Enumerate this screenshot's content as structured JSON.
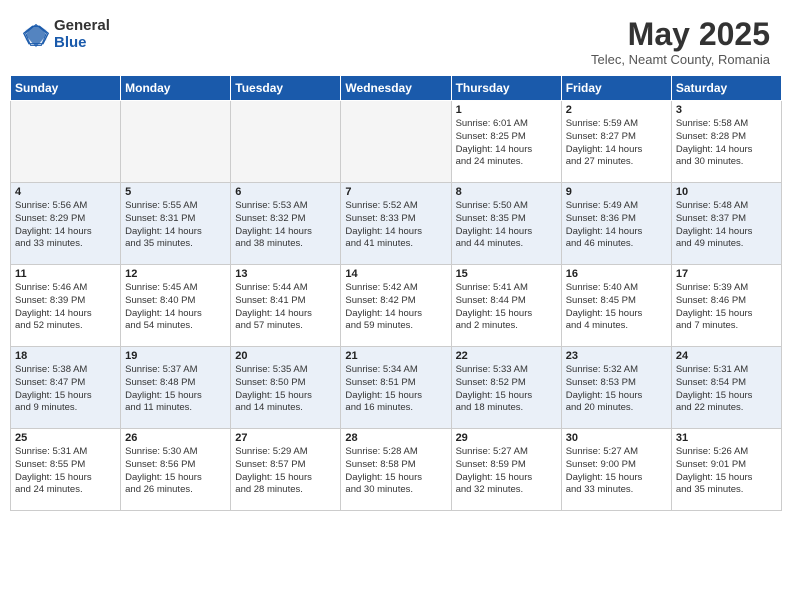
{
  "header": {
    "logo_general": "General",
    "logo_blue": "Blue",
    "title": "May 2025",
    "subtitle": "Telec, Neamt County, Romania"
  },
  "weekdays": [
    "Sunday",
    "Monday",
    "Tuesday",
    "Wednesday",
    "Thursday",
    "Friday",
    "Saturday"
  ],
  "weeks": [
    [
      {
        "day": "",
        "info": ""
      },
      {
        "day": "",
        "info": ""
      },
      {
        "day": "",
        "info": ""
      },
      {
        "day": "",
        "info": ""
      },
      {
        "day": "1",
        "info": "Sunrise: 6:01 AM\nSunset: 8:25 PM\nDaylight: 14 hours\nand 24 minutes."
      },
      {
        "day": "2",
        "info": "Sunrise: 5:59 AM\nSunset: 8:27 PM\nDaylight: 14 hours\nand 27 minutes."
      },
      {
        "day": "3",
        "info": "Sunrise: 5:58 AM\nSunset: 8:28 PM\nDaylight: 14 hours\nand 30 minutes."
      }
    ],
    [
      {
        "day": "4",
        "info": "Sunrise: 5:56 AM\nSunset: 8:29 PM\nDaylight: 14 hours\nand 33 minutes."
      },
      {
        "day": "5",
        "info": "Sunrise: 5:55 AM\nSunset: 8:31 PM\nDaylight: 14 hours\nand 35 minutes."
      },
      {
        "day": "6",
        "info": "Sunrise: 5:53 AM\nSunset: 8:32 PM\nDaylight: 14 hours\nand 38 minutes."
      },
      {
        "day": "7",
        "info": "Sunrise: 5:52 AM\nSunset: 8:33 PM\nDaylight: 14 hours\nand 41 minutes."
      },
      {
        "day": "8",
        "info": "Sunrise: 5:50 AM\nSunset: 8:35 PM\nDaylight: 14 hours\nand 44 minutes."
      },
      {
        "day": "9",
        "info": "Sunrise: 5:49 AM\nSunset: 8:36 PM\nDaylight: 14 hours\nand 46 minutes."
      },
      {
        "day": "10",
        "info": "Sunrise: 5:48 AM\nSunset: 8:37 PM\nDaylight: 14 hours\nand 49 minutes."
      }
    ],
    [
      {
        "day": "11",
        "info": "Sunrise: 5:46 AM\nSunset: 8:39 PM\nDaylight: 14 hours\nand 52 minutes."
      },
      {
        "day": "12",
        "info": "Sunrise: 5:45 AM\nSunset: 8:40 PM\nDaylight: 14 hours\nand 54 minutes."
      },
      {
        "day": "13",
        "info": "Sunrise: 5:44 AM\nSunset: 8:41 PM\nDaylight: 14 hours\nand 57 minutes."
      },
      {
        "day": "14",
        "info": "Sunrise: 5:42 AM\nSunset: 8:42 PM\nDaylight: 14 hours\nand 59 minutes."
      },
      {
        "day": "15",
        "info": "Sunrise: 5:41 AM\nSunset: 8:44 PM\nDaylight: 15 hours\nand 2 minutes."
      },
      {
        "day": "16",
        "info": "Sunrise: 5:40 AM\nSunset: 8:45 PM\nDaylight: 15 hours\nand 4 minutes."
      },
      {
        "day": "17",
        "info": "Sunrise: 5:39 AM\nSunset: 8:46 PM\nDaylight: 15 hours\nand 7 minutes."
      }
    ],
    [
      {
        "day": "18",
        "info": "Sunrise: 5:38 AM\nSunset: 8:47 PM\nDaylight: 15 hours\nand 9 minutes."
      },
      {
        "day": "19",
        "info": "Sunrise: 5:37 AM\nSunset: 8:48 PM\nDaylight: 15 hours\nand 11 minutes."
      },
      {
        "day": "20",
        "info": "Sunrise: 5:35 AM\nSunset: 8:50 PM\nDaylight: 15 hours\nand 14 minutes."
      },
      {
        "day": "21",
        "info": "Sunrise: 5:34 AM\nSunset: 8:51 PM\nDaylight: 15 hours\nand 16 minutes."
      },
      {
        "day": "22",
        "info": "Sunrise: 5:33 AM\nSunset: 8:52 PM\nDaylight: 15 hours\nand 18 minutes."
      },
      {
        "day": "23",
        "info": "Sunrise: 5:32 AM\nSunset: 8:53 PM\nDaylight: 15 hours\nand 20 minutes."
      },
      {
        "day": "24",
        "info": "Sunrise: 5:31 AM\nSunset: 8:54 PM\nDaylight: 15 hours\nand 22 minutes."
      }
    ],
    [
      {
        "day": "25",
        "info": "Sunrise: 5:31 AM\nSunset: 8:55 PM\nDaylight: 15 hours\nand 24 minutes."
      },
      {
        "day": "26",
        "info": "Sunrise: 5:30 AM\nSunset: 8:56 PM\nDaylight: 15 hours\nand 26 minutes."
      },
      {
        "day": "27",
        "info": "Sunrise: 5:29 AM\nSunset: 8:57 PM\nDaylight: 15 hours\nand 28 minutes."
      },
      {
        "day": "28",
        "info": "Sunrise: 5:28 AM\nSunset: 8:58 PM\nDaylight: 15 hours\nand 30 minutes."
      },
      {
        "day": "29",
        "info": "Sunrise: 5:27 AM\nSunset: 8:59 PM\nDaylight: 15 hours\nand 32 minutes."
      },
      {
        "day": "30",
        "info": "Sunrise: 5:27 AM\nSunset: 9:00 PM\nDaylight: 15 hours\nand 33 minutes."
      },
      {
        "day": "31",
        "info": "Sunrise: 5:26 AM\nSunset: 9:01 PM\nDaylight: 15 hours\nand 35 minutes."
      }
    ]
  ]
}
